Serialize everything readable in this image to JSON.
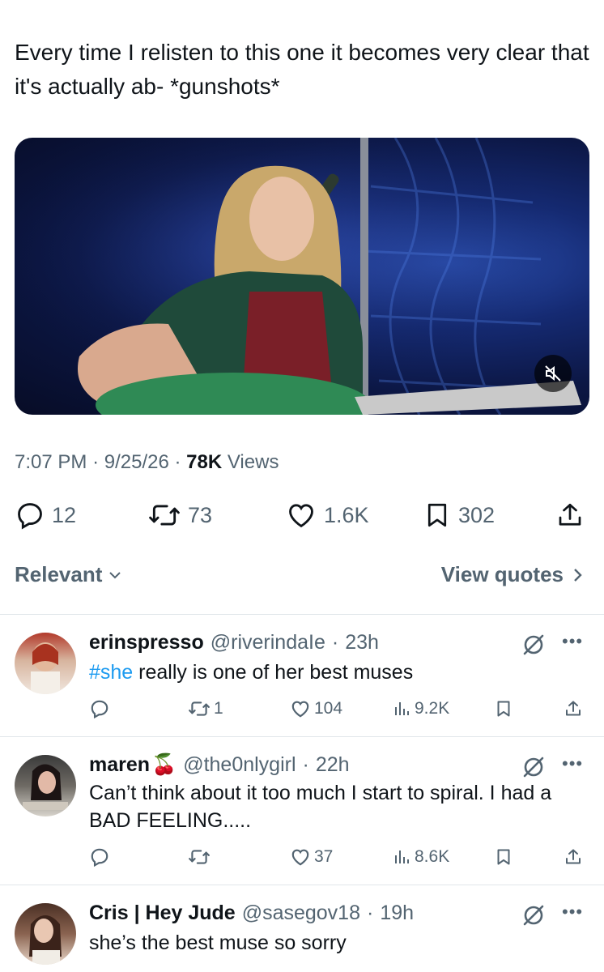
{
  "tweet": {
    "text": "Every time I relisten to this one it becomes very clear that it's actually ab- *gunshots*",
    "time": "7:07 PM",
    "date": "9/25/26",
    "views_count": "78K",
    "views_label": "Views",
    "replies": "12",
    "reposts": "73",
    "likes": "1.6K",
    "bookmarks": "302"
  },
  "filters": {
    "sort_label": "Relevant",
    "view_quotes_label": "View quotes"
  },
  "replies": [
    {
      "name": "erinspresso",
      "handle": "@riverindaIe",
      "time": "23h",
      "hashtag": "#she",
      "text": " really is one of her best muses",
      "reposts": "1",
      "likes": "104",
      "views": "9.2K"
    },
    {
      "name": "maren",
      "emoji": "🍒",
      "handle": "@the0nlygirl",
      "time": "22h",
      "text": "Can’t think about it too much I start to spiral. I had a BAD FEELING.....",
      "likes": "37",
      "views": "8.6K"
    },
    {
      "name": "Cris | Hey Jude",
      "handle": "@sasegov18",
      "time": "19h",
      "text": "she’s the best muse so sorry"
    }
  ],
  "colors": {
    "text": "#0f1419",
    "secondary": "#536471",
    "link": "#1d9bf0",
    "divider": "#e1e6ea"
  },
  "icons": [
    "reply-icon",
    "repost-icon",
    "like-icon",
    "bookmark-icon",
    "share-icon",
    "views-icon",
    "grok-icon",
    "more-icon",
    "mute-icon",
    "chevron-down-icon",
    "chevron-right-icon"
  ]
}
